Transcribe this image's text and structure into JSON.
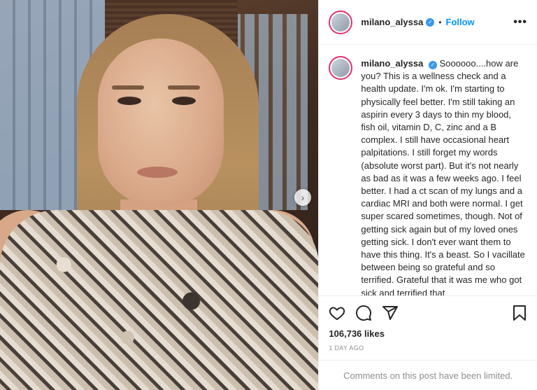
{
  "post": {
    "username": "milano_alyssa",
    "follow_label": "Follow",
    "separator": "•",
    "more_label": "•••",
    "caption": "Soooooo....how are you? This is a wellness check and a health update. I'm ok. I'm starting to physically feel better. I'm still taking an aspirin every 3 days to thin my blood, fish oil, vitamin D, C, zinc and a B complex. I still have occasional heart palpitations. I still forget my words (absolute worst part). But it's not nearly as bad as it was a few weeks ago. I feel better. I had a ct scan of my lungs and a cardiac MRI and both were normal. I get super scared sometimes, though. Not of getting sick again but of my loved ones getting sick. I don't ever want them to have this thing. It's a beast. So I vacillate between being so grateful and so terrified. Grateful that it was me who got sick and terrified that",
    "likes": "106,736 likes",
    "time": "1 DAY AGO",
    "comments_notice": "Comments on this post have been limited."
  },
  "icons": [
    "heart-icon",
    "comment-icon",
    "share-icon",
    "bookmark-icon",
    "verified-badge-icon",
    "chevron-right-icon"
  ],
  "colors": {
    "accent": "#0095f6",
    "verified": "#3897f0",
    "ring": "#e1306c",
    "muted": "#8e8e8e"
  }
}
